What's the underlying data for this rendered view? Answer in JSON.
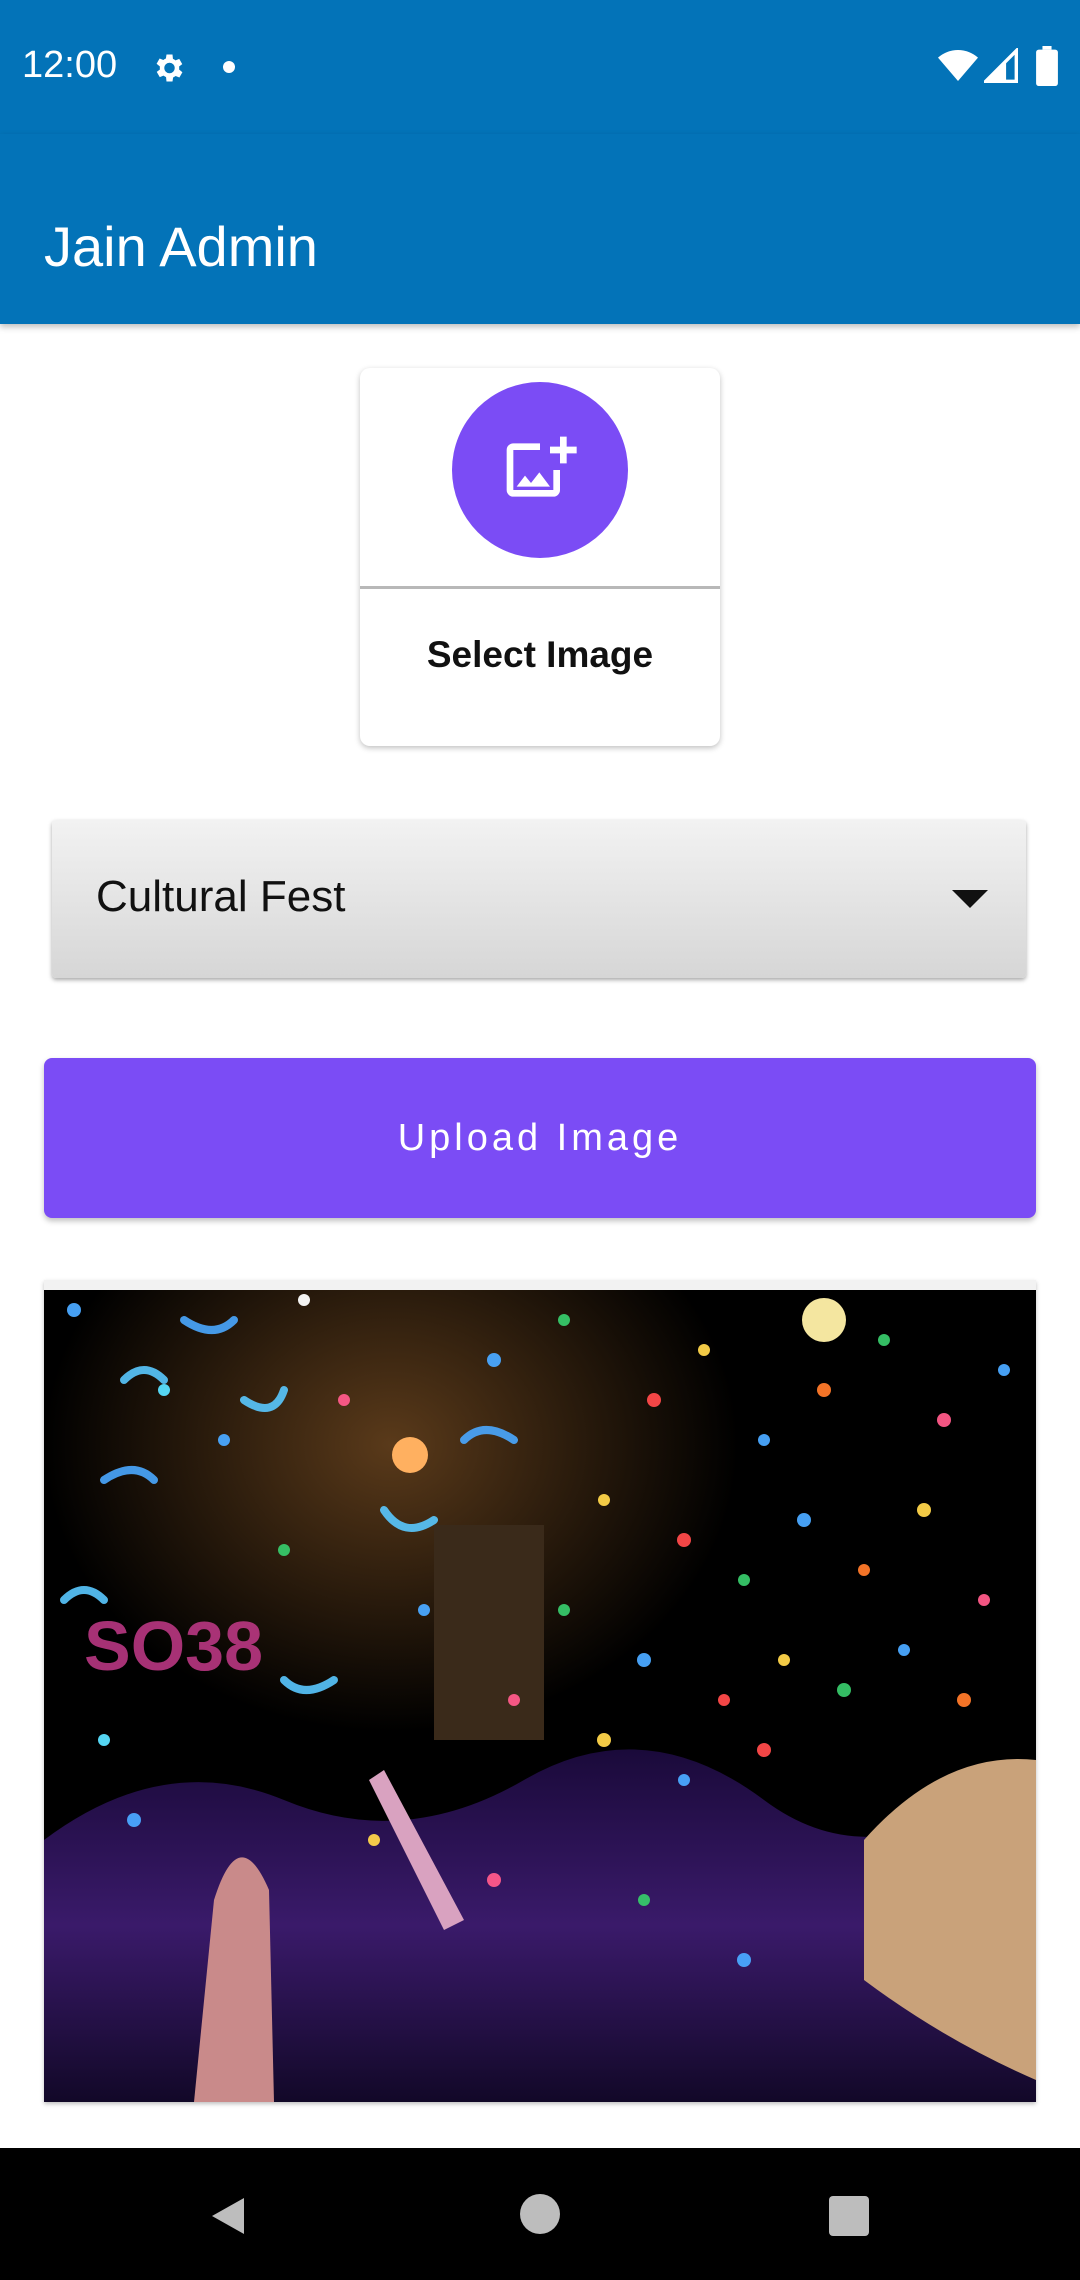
{
  "status": {
    "time": "12:00",
    "icons": [
      "gear-icon",
      "notification-dot-icon",
      "wifi-icon",
      "cell-signal-icon",
      "battery-icon"
    ]
  },
  "app": {
    "title": "Jain Admin",
    "accent_color": "#0373b8"
  },
  "select_card": {
    "label": "Select Image",
    "fab_color": "#7b4cf5",
    "icon": "add-photo-icon"
  },
  "category_spinner": {
    "selected": "Cultural Fest"
  },
  "upload_button": {
    "label": "Upload Image",
    "color": "#7b4cf5"
  },
  "preview": {
    "icon": "preview-image"
  },
  "nav": {
    "icons": [
      "back-icon",
      "home-icon",
      "recents-icon"
    ]
  }
}
